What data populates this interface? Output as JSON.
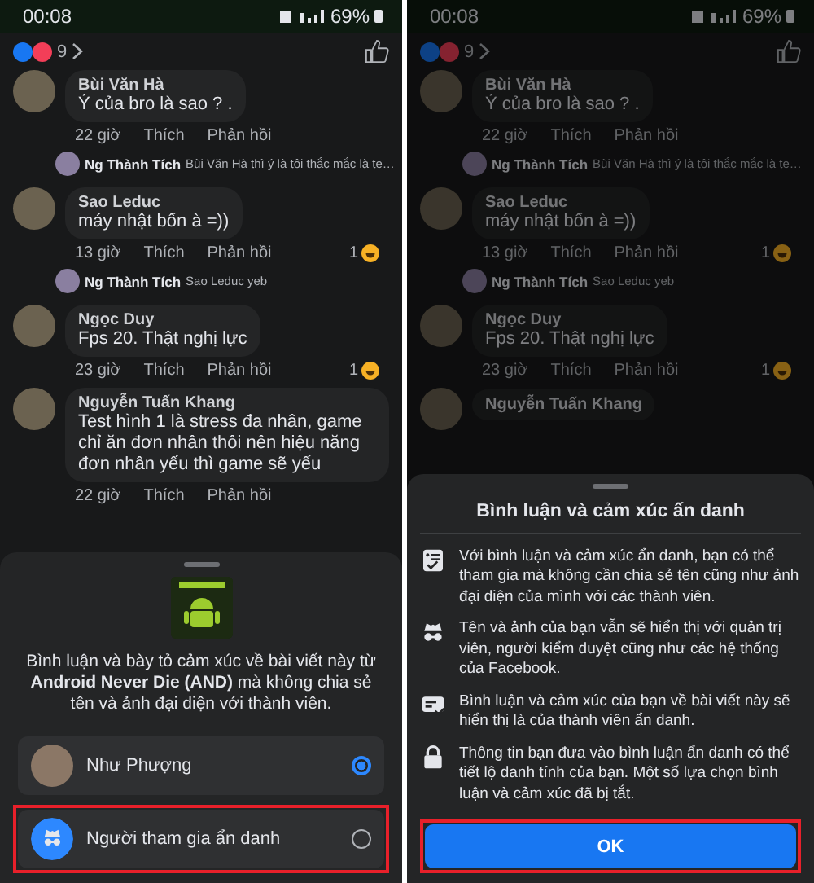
{
  "panels": [
    {
      "dimmed": false,
      "status_bar": {
        "time": "00:08",
        "battery": "69%"
      },
      "reactions": {
        "count": "9"
      },
      "comments": [
        {
          "name": "Bùi Văn Hà",
          "text": "Ý của bro là sao ? .",
          "time": "22 giờ",
          "like": "Thích",
          "reply": "Phản hồi",
          "replies": [
            {
              "name": "Ng Thành Tích",
              "text": "Bùi Văn Hà thì ý là tôi thắc mắc là te…"
            }
          ]
        },
        {
          "name": "Sao Leduc",
          "text": "máy nhật bốn à =))",
          "time": "13 giờ",
          "like": "Thích",
          "reply": "Phản hồi",
          "reaction_count": "1",
          "replies": [
            {
              "name": "Ng Thành Tích",
              "text": "Sao Leduc yeb"
            }
          ]
        },
        {
          "name": "Ngọc Duy",
          "text": "Fps 20. Thật nghị lực",
          "time": "23 giờ",
          "like": "Thích",
          "reply": "Phản hồi",
          "reaction_count": "1"
        },
        {
          "name": "Nguyễn Tuấn Khang",
          "text": "Test hình 1 là stress đa nhân, game chỉ ăn đơn nhân thôi nên hiệu năng đơn nhân yếu thì game sẽ yếu",
          "time": "22 giờ",
          "like": "Thích",
          "reply": "Phản hồi"
        }
      ],
      "sheet": {
        "kind": "picker",
        "description": "Bình luận và bày tỏ cảm xúc về bài viết này từ **Android Never Die (AND)** mà không chia sẻ tên và ảnh đại diện với thành viên.",
        "options": [
          {
            "kind": "profile",
            "label": "Như Phượng",
            "selected": true,
            "highlighted": false
          },
          {
            "kind": "anonymous",
            "label": "Người tham gia ẩn danh",
            "selected": false,
            "highlighted": true
          }
        ]
      }
    },
    {
      "dimmed": true,
      "status_bar": {
        "time": "00:08",
        "battery": "69%"
      },
      "reactions": {
        "count": "9"
      },
      "comments": [
        {
          "name": "Bùi Văn Hà",
          "text": "Ý của bro là sao ? .",
          "time": "22 giờ",
          "like": "Thích",
          "reply": "Phản hồi",
          "replies": [
            {
              "name": "Ng Thành Tích",
              "text": "Bùi Văn Hà thì ý là tôi thắc mắc là te…"
            }
          ]
        },
        {
          "name": "Sao Leduc",
          "text": "máy nhật bốn à =))",
          "time": "13 giờ",
          "like": "Thích",
          "reply": "Phản hồi",
          "reaction_count": "1",
          "replies": [
            {
              "name": "Ng Thành Tích",
              "text": "Sao Leduc yeb"
            }
          ]
        },
        {
          "name": "Ngọc Duy",
          "text": "Fps 20. Thật nghị lực",
          "time": "23 giờ",
          "like": "Thích",
          "reply": "Phản hồi",
          "reaction_count": "1"
        },
        {
          "name": "Nguyễn Tuấn Khang"
        }
      ],
      "sheet": {
        "kind": "info",
        "title": "Bình luận và cảm xúc ấn danh",
        "items": [
          {
            "kind": "checklist",
            "text": "Với bình luận và cảm xúc ẩn danh, bạn có thể tham gia mà không cần chia sẻ tên cũng như ảnh đại diện của mình với các thành viên."
          },
          {
            "kind": "incognito",
            "text": "Tên và ảnh của bạn vẫn sẽ hiển thị với quản trị viên, người kiểm duyệt cũng như các hệ thống của Facebook."
          },
          {
            "kind": "comment",
            "text": "Bình luận và cảm xúc của bạn về bài viết này sẽ hiển thị là của thành viên ẩn danh."
          },
          {
            "kind": "lock",
            "text": "Thông tin bạn đưa vào bình luận ẩn danh có thể tiết lộ danh tính của bạn. Một số lựa chọn bình luận và cảm xúc đã bị tắt."
          }
        ],
        "button": {
          "label": "OK",
          "highlighted": true
        }
      }
    }
  ]
}
